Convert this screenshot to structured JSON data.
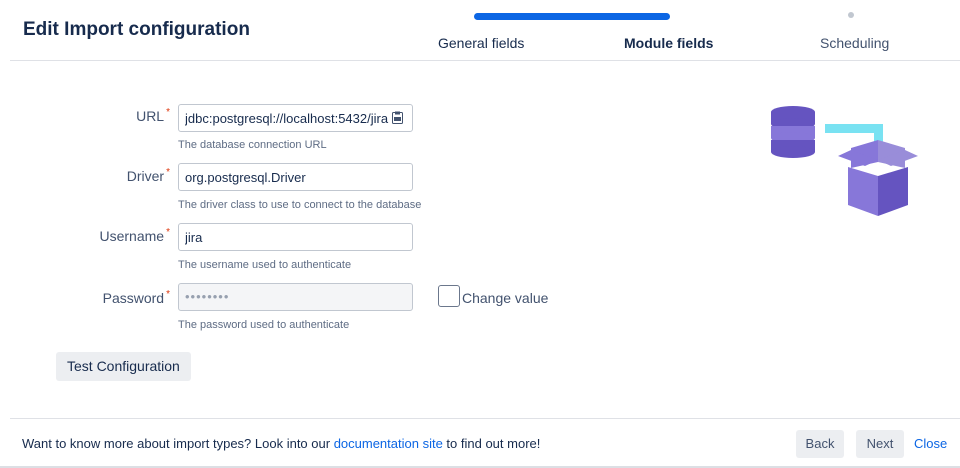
{
  "header": {
    "title": "Edit Import configuration",
    "steps": [
      {
        "label": "General fields",
        "state": "complete"
      },
      {
        "label": "Module fields",
        "state": "current"
      },
      {
        "label": "Scheduling",
        "state": "upcoming"
      }
    ],
    "accent_color": "#0c66e4"
  },
  "form": {
    "url": {
      "label": "URL",
      "value": "jdbc:postgresql://localhost:5432/jira",
      "help": "The database connection URL"
    },
    "driver": {
      "label": "Driver",
      "value": "org.postgresql.Driver",
      "help": "The driver class to use to connect to the database"
    },
    "username": {
      "label": "Username",
      "value": "jira",
      "help": "The username used to authenticate"
    },
    "password": {
      "label": "Password",
      "value": "••••••••",
      "help": "The password used to authenticate"
    },
    "change_value_label": "Change value",
    "required_marker": "*",
    "test_button": "Test Configuration"
  },
  "footer": {
    "text_before": "Want to know more about import types? Look into our ",
    "link_text": "documentation site",
    "text_after": " to find out more!",
    "back": "Back",
    "next": "Next",
    "close": "Close"
  },
  "icons": {
    "url_field_icon": "clipboard-icon",
    "illustration": "database-to-box-illustration"
  }
}
